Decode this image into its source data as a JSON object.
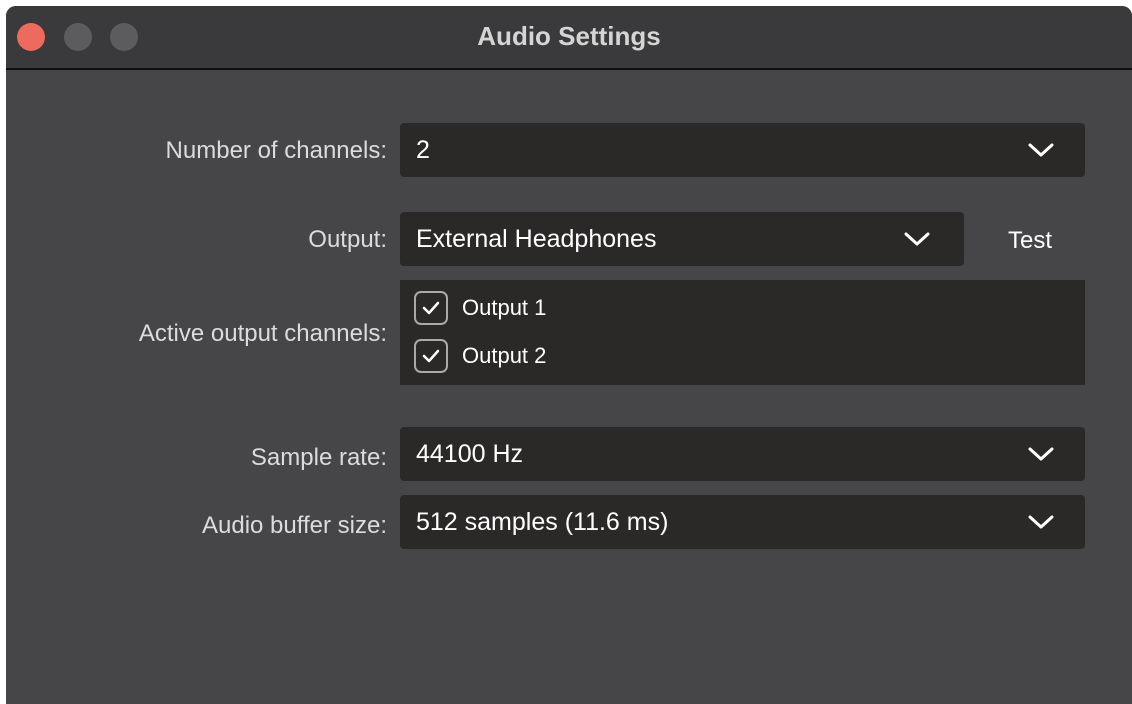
{
  "window": {
    "title": "Audio Settings"
  },
  "fields": {
    "channels": {
      "label": "Number of channels:",
      "value": "2"
    },
    "output": {
      "label": "Output:",
      "value": "External Headphones",
      "test_label": "Test"
    },
    "active_channels": {
      "label": "Active output channels:",
      "items": [
        {
          "label": "Output 1",
          "checked": true
        },
        {
          "label": "Output 2",
          "checked": true
        }
      ]
    },
    "sample_rate": {
      "label": "Sample rate:",
      "value": "44100 Hz"
    },
    "buffer_size": {
      "label": "Audio buffer size:",
      "value": "512 samples (11.6 ms)"
    }
  },
  "colors": {
    "window_bg": "#464548",
    "titlebar_bg": "#3a393b",
    "control_bg": "#2b2828",
    "close_button": "#ed6a5e",
    "inactive_button": "#5c5b5e"
  }
}
